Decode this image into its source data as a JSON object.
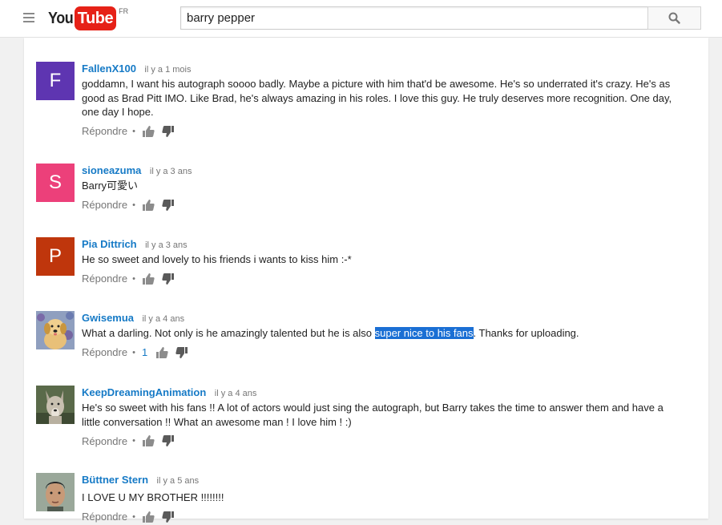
{
  "header": {
    "logo_you": "You",
    "logo_tube": "Tube",
    "logo_country": "FR",
    "search_value": "barry pepper"
  },
  "icons": {
    "menu": "hamburger-menu-icon",
    "search": "magnifier-search-icon",
    "like": "thumbs-up-icon",
    "dislike": "thumbs-down-icon"
  },
  "colors": {
    "author_link": "#167ac6",
    "selection_highlight": "#1a6fd4",
    "youtube_red": "#e62117"
  },
  "comments": [
    {
      "avatar_letter": "F",
      "avatar_color": "#5e35b1",
      "author": "FallenX100",
      "time": "il y a 1 mois",
      "text": "goddamn, I want his autograph soooo badly. Maybe a picture with him that'd be awesome. He's so underrated it's crazy. He's as good as Brad Pitt IMO. Like Brad, he's always amazing in his roles. I love this guy. He truly deserves more recognition. One day, one day I hope.",
      "reply": "Répondre",
      "likes": ""
    },
    {
      "avatar_letter": "S",
      "avatar_color": "#ec407a",
      "author": "sioneazuma",
      "time": "il y a 3 ans",
      "text": "Barry可愛い",
      "reply": "Répondre",
      "likes": ""
    },
    {
      "avatar_letter": "P",
      "avatar_color": "#bf360c",
      "author": "Pia Dittrich",
      "time": "il y a 3 ans",
      "text": "He so sweet and lovely to his friends i wants to kiss him :-*",
      "reply": "Répondre",
      "likes": ""
    },
    {
      "avatar_letter": "",
      "avatar_color": "#8a9bb5",
      "author": "Gwisemua",
      "time": "il y a 4 ans",
      "text_before": "What a darling. Not only is he amazingly talented but he is also ",
      "text_highlight": "super nice to his fans",
      "text_after": ". Thanks for uploading.",
      "reply": "Répondre",
      "likes": "1"
    },
    {
      "avatar_letter": "",
      "avatar_color": "#6b5e4a",
      "author": "KeepDreamingAnimation",
      "time": "il y a 4 ans",
      "text": "He's so sweet with his fans !! A lot of actors would just sing the autograph, but Barry takes the time to answer them and have a little conversation !! What an awesome man ! I love him ! :)",
      "reply": "Répondre",
      "likes": ""
    },
    {
      "avatar_letter": "",
      "avatar_color": "#7a8a7c",
      "author": "Büttner Stern",
      "time": "il y a 5 ans",
      "text": "I LOVE U MY BROTHER !!!!!!!!",
      "reply": "Répondre",
      "likes": ""
    }
  ]
}
